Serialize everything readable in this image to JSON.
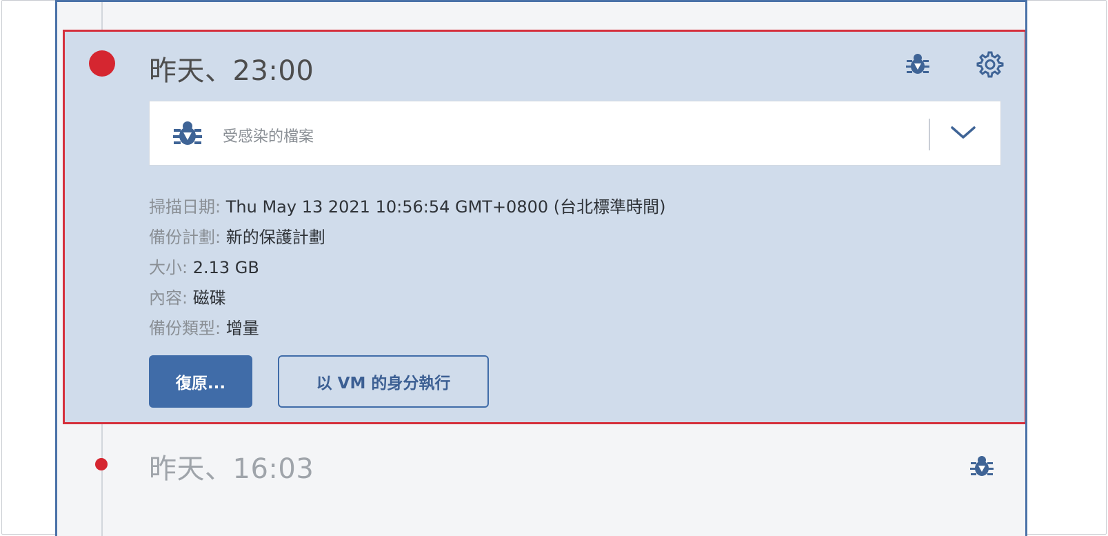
{
  "entries": [
    {
      "title": "昨天、23:00",
      "status_color": "#d52630",
      "icons": [
        "bug-icon",
        "gear-icon"
      ],
      "dropdown": {
        "icon": "bug-icon",
        "label": "受感染的檔案",
        "chevron": "chevron-down-icon"
      },
      "details": [
        {
          "key": "掃描日期:",
          "value": "Thu May 13 2021 10:56:54 GMT+0800 (台北標準時間)"
        },
        {
          "key": "備份計劃:",
          "value": "新的保護計劃"
        },
        {
          "key": "大小:",
          "value": "2.13 GB"
        },
        {
          "key": "內容:",
          "value": "磁碟"
        },
        {
          "key": "備份類型:",
          "value": "增量"
        }
      ],
      "buttons": {
        "recover": "復原...",
        "run_as_vm": "以 VM 的身分執行"
      }
    },
    {
      "title": "昨天、16:03",
      "status_color": "#d52630",
      "icons": [
        "bug-icon"
      ]
    }
  ],
  "colors": {
    "accent": "#406ca8",
    "selected_bg": "#d0dceb",
    "highlight_border": "#d52f3b",
    "status_red": "#d52630"
  }
}
